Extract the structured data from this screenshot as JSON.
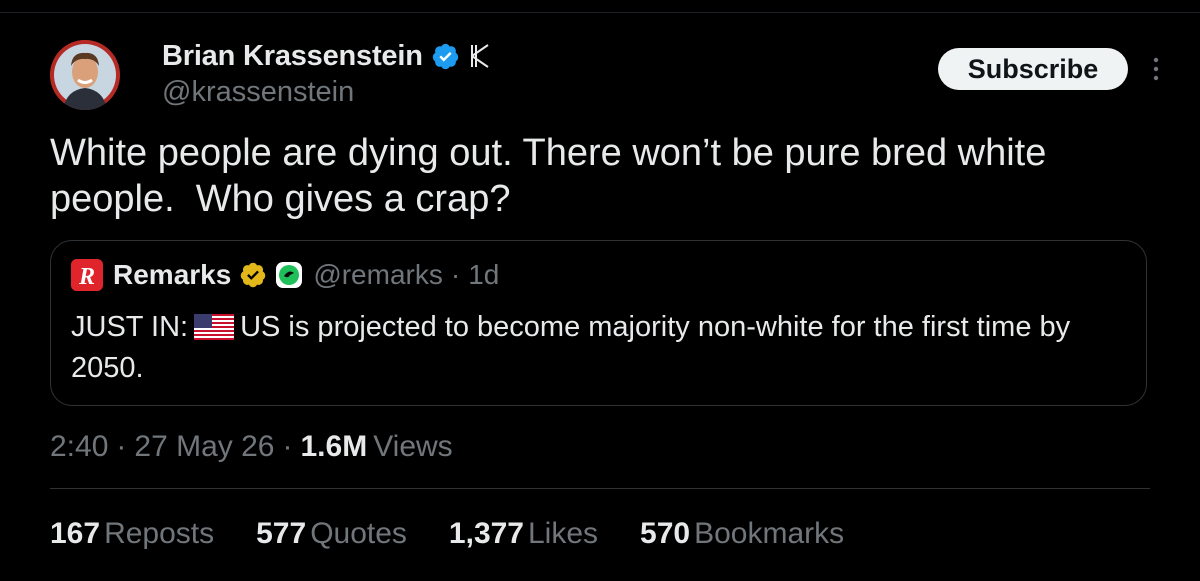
{
  "author": {
    "name": "Brian Krassenstein",
    "handle": "@krassenstein",
    "badge_letter": "K"
  },
  "subscribe_label": "Subscribe",
  "tweet": {
    "text": "White people are dying out. There won’t be pure bred white\npeople.  Who gives a crap?"
  },
  "quote": {
    "logo_letter": "R",
    "name": "Remarks",
    "handle": "@remarks",
    "dot": "·",
    "time": "1d",
    "text_prefix": "JUST IN:",
    "text_body": "US is projected to become majority non-white for the first time by 2050."
  },
  "meta": {
    "time": "2:40",
    "sep1": "·",
    "date": "27 May 26",
    "sep2": "·",
    "views_count": "1.6M",
    "views_label": "Views"
  },
  "stats": [
    {
      "count": "167",
      "label": "Reposts"
    },
    {
      "count": "577",
      "label": "Quotes"
    },
    {
      "count": "1,377",
      "label": "Likes"
    },
    {
      "count": "570",
      "label": "Bookmarks"
    }
  ],
  "colors": {
    "background": "#000000",
    "text": "#e7e9ea",
    "muted": "#71767b",
    "verified_blue": "#1d9bf0",
    "verified_gold": "#e2b719",
    "remarks_red": "#e0242b",
    "border": "#2f3336"
  }
}
